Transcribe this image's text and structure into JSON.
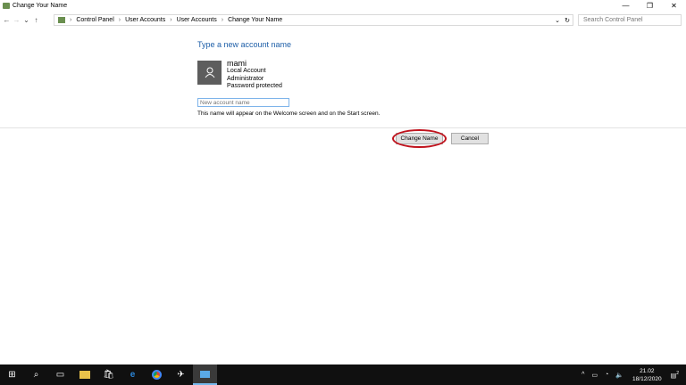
{
  "window": {
    "title": "Change Your Name",
    "minimize": "—",
    "maximize": "❐",
    "close": "✕"
  },
  "nav": {
    "back": "←",
    "forward": "→",
    "recent": "⌄",
    "up": "↑",
    "breadcrumb": [
      "Control Panel",
      "User Accounts",
      "User Accounts",
      "Change Your Name"
    ],
    "refresh": "↻",
    "dropdown": "⌄",
    "search_placeholder": "Search Control Panel"
  },
  "main": {
    "heading": "Type a new account name",
    "user": {
      "name": "mami",
      "lines": [
        "Local Account",
        "Administrator",
        "Password protected"
      ]
    },
    "input_placeholder": "New account name",
    "input_value": "",
    "hint": "This name will appear on the Welcome screen and on the Start screen.",
    "change_button": "Change Name",
    "cancel_button": "Cancel"
  },
  "taskbar": {
    "time": "21.02",
    "date": "18/12/2020",
    "notifications": "2"
  }
}
